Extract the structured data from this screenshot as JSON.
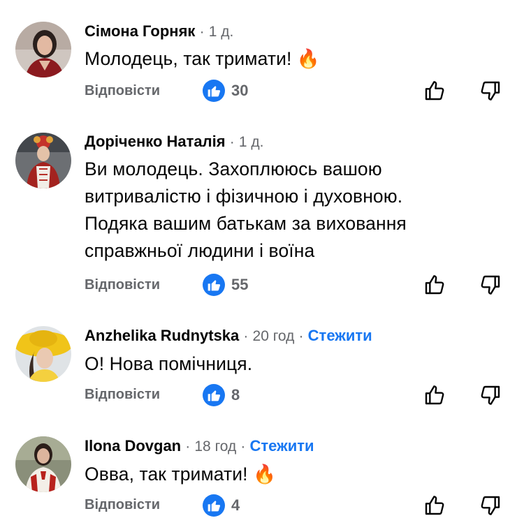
{
  "comments": [
    {
      "author": "Сімона Горняк",
      "time": "1 д.",
      "follow": "",
      "text_lines": [
        "Молодець, так тримати! 🔥"
      ],
      "reply": "Відповісти",
      "likes": "30",
      "avatar_icon": "user-photo"
    },
    {
      "author": "Доріченко Наталія",
      "time": "1 д.",
      "follow": "",
      "text_lines": [
        "Ви молодець. Захоплююсь вашою",
        "витривалістю і фізичною і духовною.",
        "Подяка вашим батькам за виховання",
        "справжньої людини і воїна"
      ],
      "reply": "Відповісти",
      "likes": "55",
      "avatar_icon": "user-photo"
    },
    {
      "author": "Anzhelika Rudnytska",
      "time": "20 год",
      "follow": "Стежити",
      "text_lines": [
        "О! Нова помічниця."
      ],
      "reply": "Відповісти",
      "likes": "8",
      "avatar_icon": "user-photo"
    },
    {
      "author": "Ilona Dovgan",
      "time": "18 год",
      "follow": "Стежити",
      "text_lines": [
        "Овва, так тримати! 🔥"
      ],
      "reply": "Відповісти",
      "likes": "4",
      "avatar_icon": "user-photo"
    }
  ],
  "separator": "·",
  "icons": {
    "like_badge": "thumbs-up-icon",
    "like_button": "thumbs-up-outline-icon",
    "dislike_button": "thumbs-down-outline-icon"
  },
  "colors": {
    "link_blue": "#1877f2",
    "meta_gray": "#65676b",
    "text": "#050505"
  }
}
